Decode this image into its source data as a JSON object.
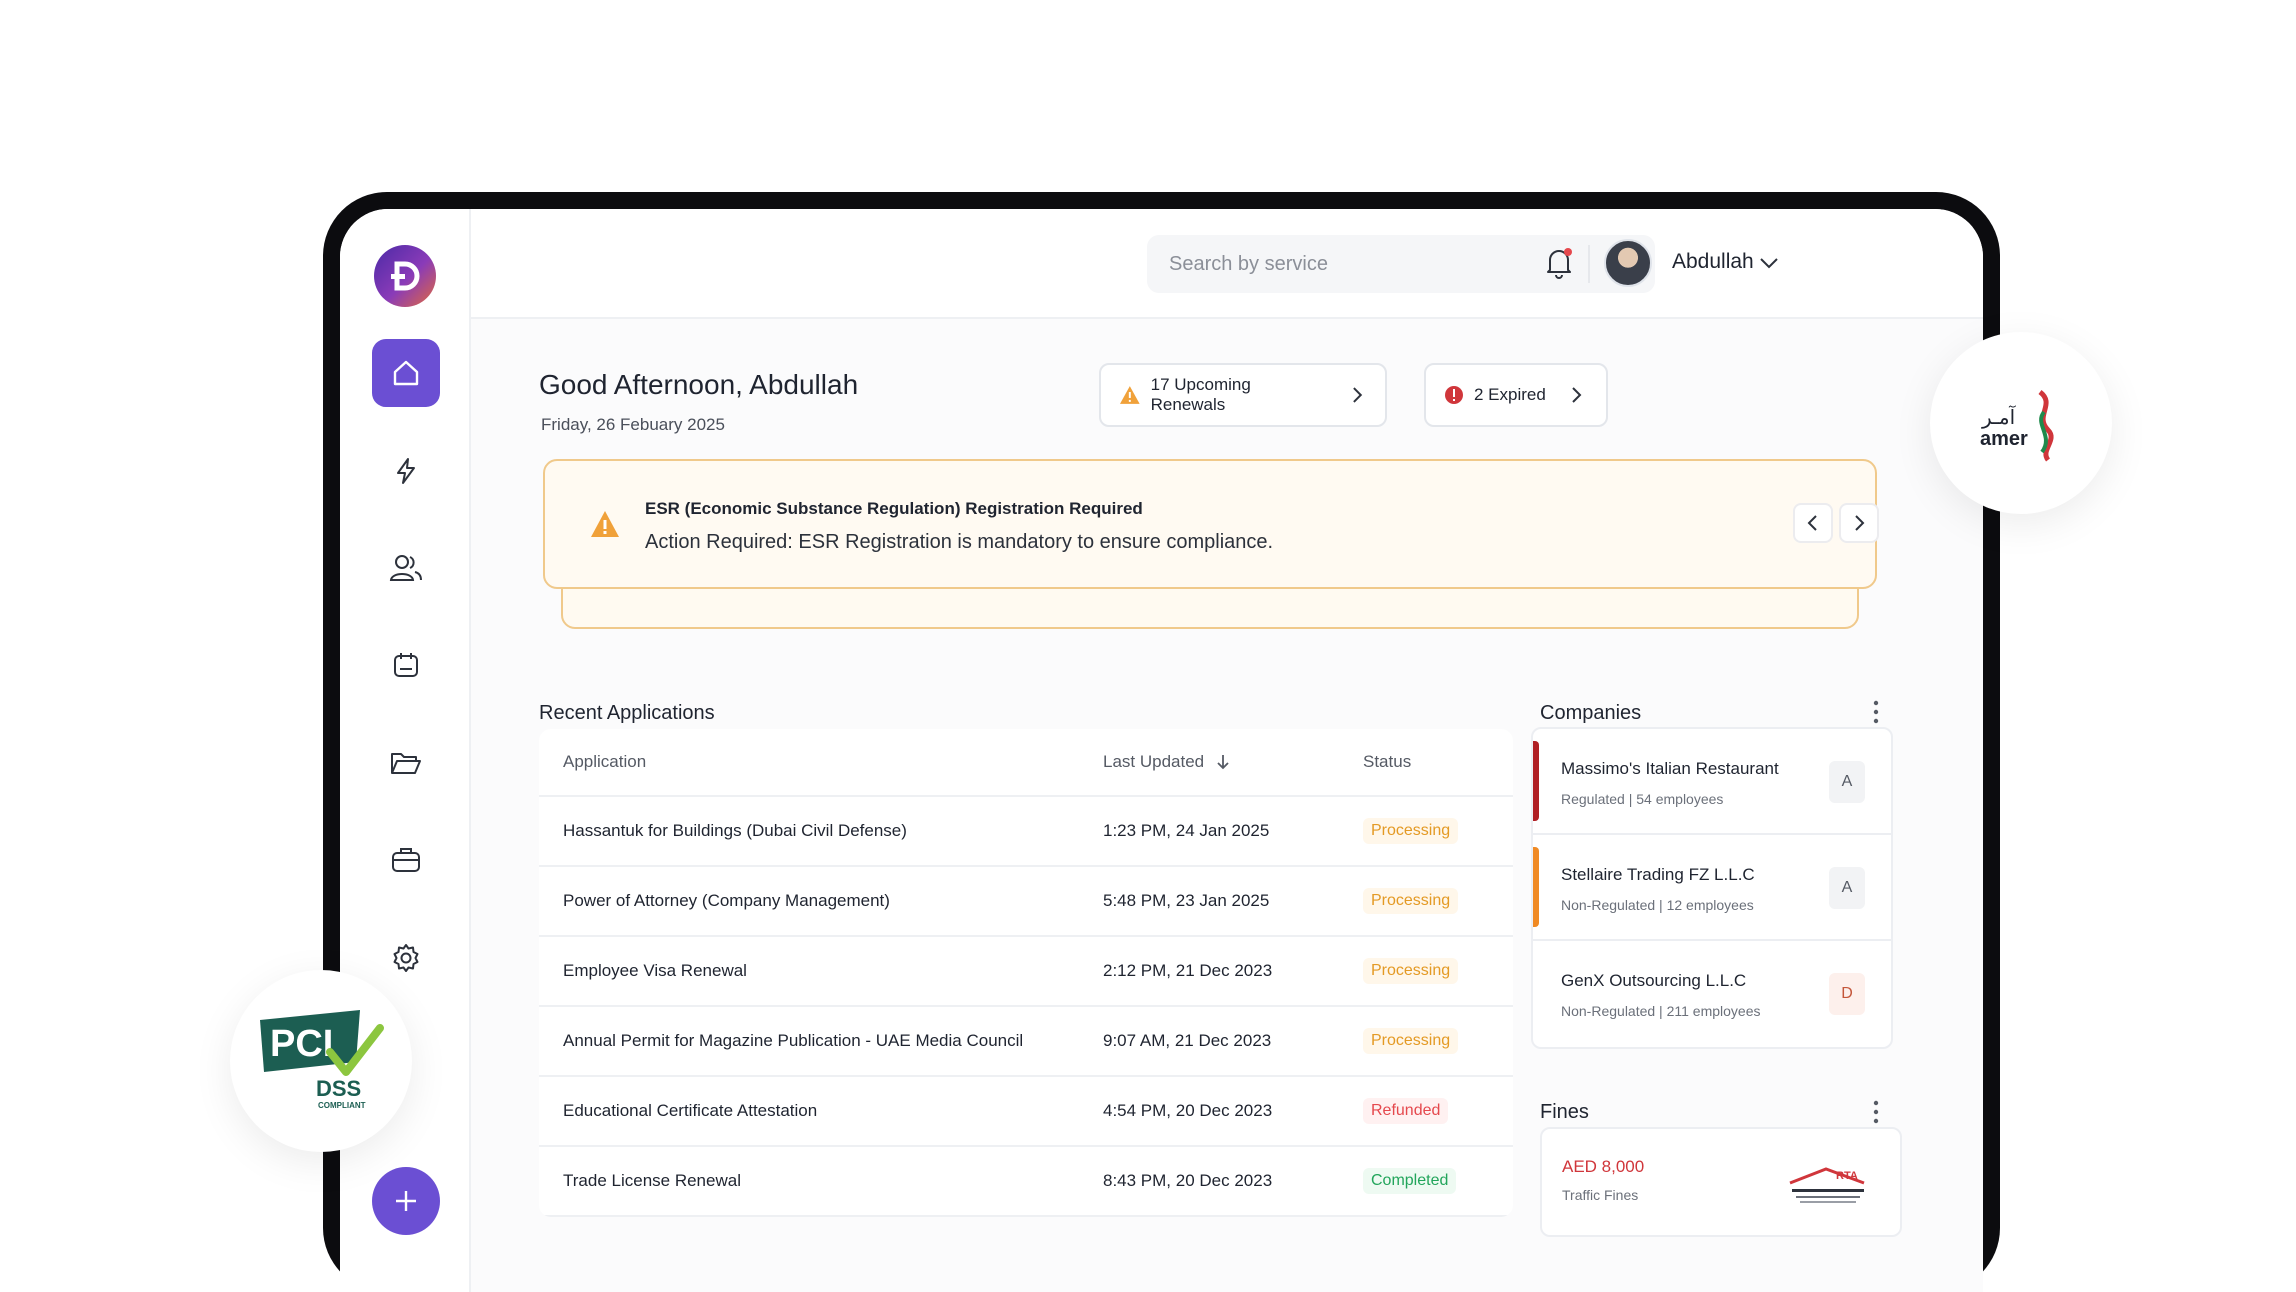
{
  "user": {
    "name": "Abdullah"
  },
  "search": {
    "placeholder": "Search by service"
  },
  "greeting": {
    "title": "Good Afternoon, Abdullah",
    "date": "Friday, 26 Febuary 2025"
  },
  "pills": {
    "renewals": "17 Upcoming Renewals",
    "expired": "2 Expired"
  },
  "alert": {
    "title": "ESR (Economic Substance Regulation) Registration Required",
    "text": "Action Required: ESR Registration is mandatory to ensure compliance."
  },
  "applications": {
    "title": "Recent Applications",
    "headers": {
      "application": "Application",
      "updated": "Last Updated",
      "status": "Status"
    },
    "rows": [
      {
        "name": "Hassantuk for Buildings (Dubai Civil Defense)",
        "updated": "1:23 PM, 24 Jan 2025",
        "status": "Processing"
      },
      {
        "name": "Power of Attorney (Company Management)",
        "updated": "5:48 PM, 23 Jan 2025",
        "status": "Processing"
      },
      {
        "name": "Employee Visa Renewal",
        "updated": "2:12 PM, 21 Dec 2023",
        "status": "Processing"
      },
      {
        "name": "Annual Permit for Magazine Publication - UAE Media Council",
        "updated": "9:07 AM, 21 Dec 2023",
        "status": "Processing"
      },
      {
        "name": "Educational Certificate Attestation",
        "updated": "4:54 PM, 20 Dec 2023",
        "status": "Refunded"
      },
      {
        "name": "Trade License Renewal",
        "updated": "8:43 PM, 20 Dec 2023",
        "status": "Completed"
      }
    ]
  },
  "companies": {
    "title": "Companies",
    "items": [
      {
        "name": "Massimo's Italian Restaurant",
        "meta": "Regulated | 54 employees",
        "letter": "A",
        "accent": "#b01f24"
      },
      {
        "name": "Stellaire Trading FZ L.L.C",
        "meta": "Non-Regulated |  12 employees",
        "letter": "A",
        "accent": "#f08a24"
      },
      {
        "name": "GenX Outsourcing L.L.C",
        "meta": "Non-Regulated | 211 employees",
        "letter": "D",
        "accent": ""
      }
    ]
  },
  "fines": {
    "title": "Fines",
    "amount": "AED 8,000",
    "label": "Traffic Fines",
    "issuer_logo": "RTA"
  },
  "badges": {
    "amer_arabic": "آمـر",
    "amer_latin": "amer",
    "pci": "PCI",
    "dss": "DSS",
    "compliant": "COMPLIANT"
  },
  "colors": {
    "accent": "#6b4fd3",
    "warning": "#f0a13a",
    "danger": "#d0363b",
    "success": "#22a55b"
  }
}
